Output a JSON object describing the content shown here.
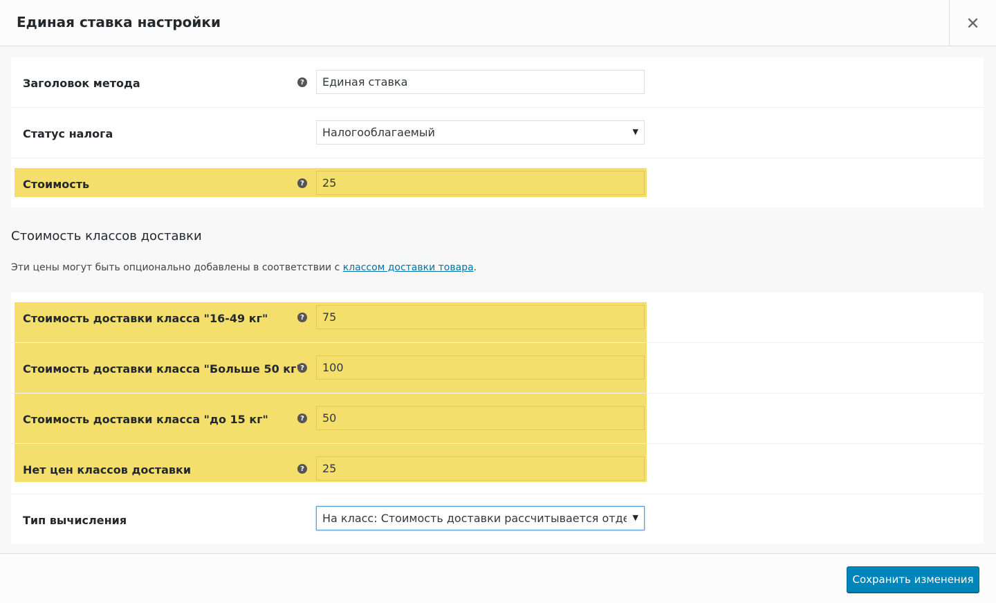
{
  "modal": {
    "title": "Единая ставка настройки",
    "close_glyph": "✕"
  },
  "general": {
    "method_title": {
      "label": "Заголовок метода",
      "value": "Единая ставка"
    },
    "tax_status": {
      "label": "Статус налога",
      "value": "Налогооблагаемый"
    },
    "cost": {
      "label": "Стоимость",
      "value": "25"
    }
  },
  "shipping_classes": {
    "title": "Стоимость классов доставки",
    "description_before": "Эти цены могут быть опционально добавлены в соответствии с ",
    "description_link": "классом доставки товара",
    "description_after": ".",
    "rows": [
      {
        "label": "Стоимость доставки класса \"16-49 кг\"",
        "value": "75"
      },
      {
        "label": "Стоимость доставки класса \"Больше 50 кг\"",
        "value": "100"
      },
      {
        "label": "Стоимость доставки класса \"до 15 кг\"",
        "value": "50"
      },
      {
        "label": "Нет цен классов доставки",
        "value": "25"
      }
    ],
    "calc_type": {
      "label": "Тип вычисления",
      "value": "На класс: Стоимость доставки рассчитывается отдельно для каждого класса"
    }
  },
  "footer": {
    "save_label": "Сохранить изменения"
  },
  "icons": {
    "help": "?",
    "select_arrow": "▼"
  },
  "colors": {
    "highlight": "#f4df6c",
    "primary_button": "#0085ba",
    "link": "#0073aa"
  }
}
